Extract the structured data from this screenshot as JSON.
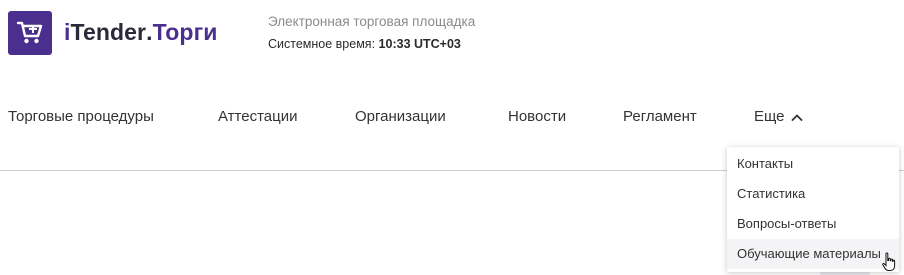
{
  "header": {
    "brand_i": "i",
    "brand_main": "Tender",
    "brand_dot": ".",
    "brand_sub": "Торги",
    "tagline": "Электронная торговая площадка",
    "systime_label": "Системное время:",
    "systime_value": "10:33 UTC+03",
    "logo_icon": "shopping-cart-icon",
    "brand_color": "#4b2f8f"
  },
  "nav": {
    "items": [
      {
        "label": "Торговые процедуры"
      },
      {
        "label": "Аттестации"
      },
      {
        "label": "Организации"
      },
      {
        "label": "Новости"
      },
      {
        "label": "Регламент"
      },
      {
        "label": "Еще"
      }
    ]
  },
  "dropdown": {
    "items": [
      {
        "label": "Контакты"
      },
      {
        "label": "Статистика"
      },
      {
        "label": "Вопросы-ответы"
      },
      {
        "label": "Обучающие материалы"
      }
    ]
  }
}
